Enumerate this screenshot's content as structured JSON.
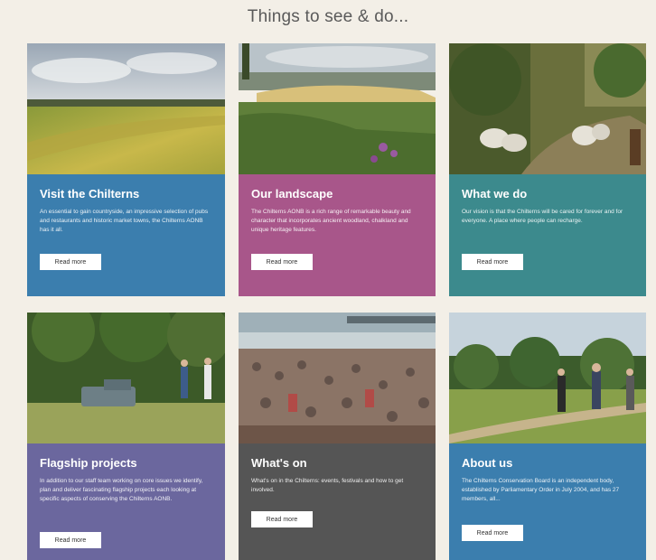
{
  "page": {
    "title": "Things to see & do..."
  },
  "cards": [
    {
      "title": "Visit the Chilterns",
      "description": "An essential to gain countryside, an impressive selection of pubs and restaurants and historic market towns, the Chilterns AONB has it all.",
      "button": "Read more",
      "color": "#3b7eae"
    },
    {
      "title": "Our landscape",
      "description": "The Chilterns AONB is a rich range of remarkable beauty and character that incorporates ancient woodland, chalkland and unique heritage features.",
      "button": "Read more",
      "color": "#a8568a"
    },
    {
      "title": "What we do",
      "description": "Our vision is that the Chilterns will be cared for forever and for everyone. A place where people can recharge.",
      "button": "Read more",
      "color": "#3c8a8d"
    },
    {
      "title": "Flagship projects",
      "description": "In addition to our staff team working on core issues we identify, plan and deliver fascinating flagship projects each looking at specific aspects of conserving the Chilterns AONB.",
      "button": "Read more",
      "color": "#6b679e"
    },
    {
      "title": "What's on",
      "description": "What's on in the Chilterns: events, festivals and how to get involved.",
      "button": "Read more",
      "color": "#555555"
    },
    {
      "title": "About us",
      "description": "The Chilterns Conservation Board is an independent body, established by Parliamentary Order in July 2004, and has 27 members, all...",
      "button": "Read more",
      "color": "#3b7eae"
    }
  ]
}
